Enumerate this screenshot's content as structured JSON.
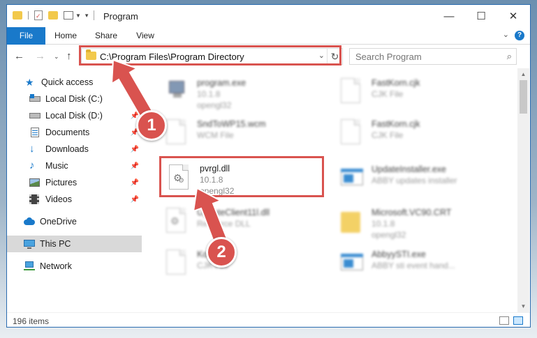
{
  "window": {
    "title": "Program",
    "controls": {
      "minimize": "—",
      "maximize": "☐",
      "close": "✕"
    }
  },
  "ribbon": {
    "tabs": [
      "File",
      "Home",
      "Share",
      "View"
    ],
    "help": "?"
  },
  "nav": {
    "address": "C:\\Program Files\\Program Directory",
    "search_placeholder": "Search Program"
  },
  "sidebar": {
    "items": [
      {
        "label": "Quick access",
        "icon": "star-icon",
        "pinned": false
      },
      {
        "label": "Local Disk (C:)",
        "icon": "disk-icon",
        "pinned": true
      },
      {
        "label": "Local Disk (D:)",
        "icon": "disk-icon",
        "pinned": true
      },
      {
        "label": "Documents",
        "icon": "documents-icon",
        "pinned": true
      },
      {
        "label": "Downloads",
        "icon": "download-icon",
        "pinned": true
      },
      {
        "label": "Music",
        "icon": "music-icon",
        "pinned": true
      },
      {
        "label": "Pictures",
        "icon": "pictures-icon",
        "pinned": true
      },
      {
        "label": "Videos",
        "icon": "videos-icon",
        "pinned": true
      },
      {
        "label": "OneDrive",
        "icon": "cloud-icon",
        "pinned": false
      },
      {
        "label": "This PC",
        "icon": "pc-icon",
        "pinned": false,
        "selected": true
      },
      {
        "label": "Network",
        "icon": "network-icon",
        "pinned": false
      }
    ]
  },
  "files": [
    {
      "name": "program.exe",
      "line2": "10.1.8",
      "line3": "opengl32",
      "icon": "exe-icon",
      "blurred": true
    },
    {
      "name": "FastKorn.cjk",
      "line2": "CJK File",
      "line3": "",
      "icon": "document-icon",
      "blurred": true
    },
    {
      "name": "SndToWP15.wcm",
      "line2": "WCM File",
      "line3": "",
      "icon": "document-icon",
      "blurred": true
    },
    {
      "name": "FastKorn.cjk",
      "line2": "CJK File",
      "line3": "",
      "icon": "document-icon",
      "blurred": true
    },
    {
      "name": "pvrgl.dll",
      "line2": "10.1.8",
      "line3": "opengl32",
      "icon": "dll-gear-icon",
      "blurred": false
    },
    {
      "name": "UpdateInstaller.exe",
      "line2": "ABBY updates installer",
      "line3": "",
      "icon": "app-window-icon",
      "blurred": true
    },
    {
      "name": "UpdateClient11l.dll",
      "line2": "Resource DLL",
      "line3": "",
      "icon": "dll-gear-icon",
      "blurred": true
    },
    {
      "name": "Microsoft.VC90.CRT",
      "line2": "10.1.8",
      "line3": "opengl32",
      "icon": "folder-icon",
      "blurred": true
    },
    {
      "name": "Korn.cjk",
      "line2": "CJK File",
      "line3": "",
      "icon": "document-icon",
      "blurred": true
    },
    {
      "name": "AbbyySTI.exe",
      "line2": "ABBY sti event hand...",
      "line3": "",
      "icon": "app-window-icon",
      "blurred": true
    }
  ],
  "status": {
    "count": "196 items"
  },
  "annotations": {
    "badge1": "1",
    "badge2": "2"
  },
  "colors": {
    "accent": "#1979ca",
    "highlight": "#d9534f",
    "folder": "#f2c94c"
  }
}
